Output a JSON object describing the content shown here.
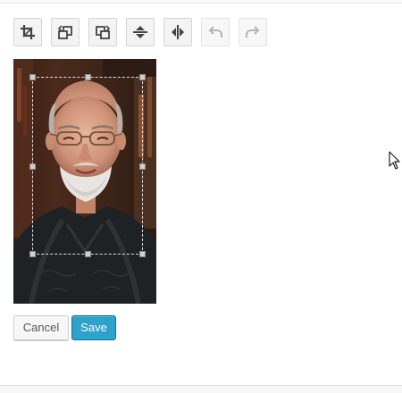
{
  "toolbar": {
    "tools": [
      {
        "name": "crop",
        "icon": "crop-icon",
        "enabled": true
      },
      {
        "name": "rotate-left",
        "icon": "rotate-left-icon",
        "enabled": true
      },
      {
        "name": "rotate-right",
        "icon": "rotate-right-icon",
        "enabled": true
      },
      {
        "name": "flip-vertical",
        "icon": "flip-vertical-icon",
        "enabled": true
      },
      {
        "name": "flip-horizontal",
        "icon": "flip-horizontal-icon",
        "enabled": true
      },
      {
        "name": "undo",
        "icon": "undo-icon",
        "enabled": false
      },
      {
        "name": "redo",
        "icon": "redo-icon",
        "enabled": false
      }
    ]
  },
  "image": {
    "description_icon": "portrait-photo",
    "crop_active": true
  },
  "actions": {
    "cancel_label": "Cancel",
    "save_label": "Save"
  },
  "colors": {
    "save_bg": "#2ea2cc",
    "save_border": "#0074a2",
    "tool_bg": "#f3f3f3",
    "tool_icon": "#444444",
    "tool_icon_disabled": "#b4b4b4"
  }
}
